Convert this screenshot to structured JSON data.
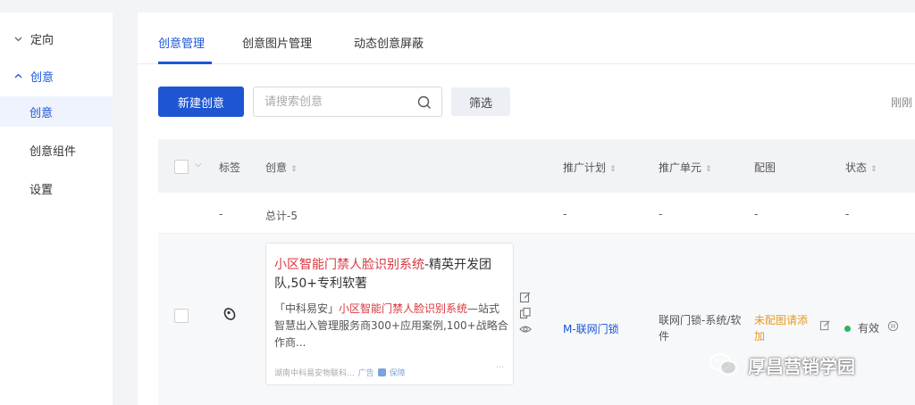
{
  "sidebar": {
    "group1": {
      "label": "定向",
      "icon": "chevron-down-icon"
    },
    "group2": {
      "label": "创意",
      "icon": "chevron-up-icon"
    },
    "items": [
      {
        "label": "创意",
        "selected": true
      },
      {
        "label": "创意组件",
        "selected": false
      },
      {
        "label": "设置",
        "selected": false
      }
    ]
  },
  "tabs": [
    {
      "label": "创意管理",
      "active": true
    },
    {
      "label": "创意图片管理",
      "active": false
    },
    {
      "label": "动态创意屏蔽",
      "active": false
    }
  ],
  "toolbar": {
    "new_button": "新建创意",
    "search_placeholder": "请搜索创意",
    "filter_button": "筛选",
    "right_text": "刚刚"
  },
  "table": {
    "headers": {
      "tag": "标签",
      "creative": "创意",
      "plan": "推广计划",
      "unit": "推广单元",
      "image": "配图",
      "status": "状态"
    },
    "total_row": {
      "tag": "-",
      "creative": "总计-5",
      "plan": "-",
      "unit": "-",
      "image": "-",
      "status": "-"
    },
    "rows": [
      {
        "title_highlight": "小区智能门禁人脸识别系统",
        "title_rest": "-精英开发团队,50+专利软著",
        "desc_prefix": "「中科易安」",
        "desc_highlight": "小区智能门禁人脸识别系统",
        "desc_rest": "—站式智慧出入管理服务商300+应用案例,100+战略合作商...",
        "footer_source": "湖南中科易安物联科...",
        "footer_ad": "广告",
        "footer_badge": "保障",
        "more": "···",
        "plan": "M-联网门锁",
        "unit": "联网门锁-系统/软件",
        "image": "未配图请添加",
        "status": "有效"
      }
    ]
  },
  "watermark": {
    "text": "厚昌营销学园"
  },
  "colors": {
    "primary": "#1e56d2",
    "highlight": "#d9363e",
    "warning": "#e79a21",
    "success": "#2db464"
  }
}
